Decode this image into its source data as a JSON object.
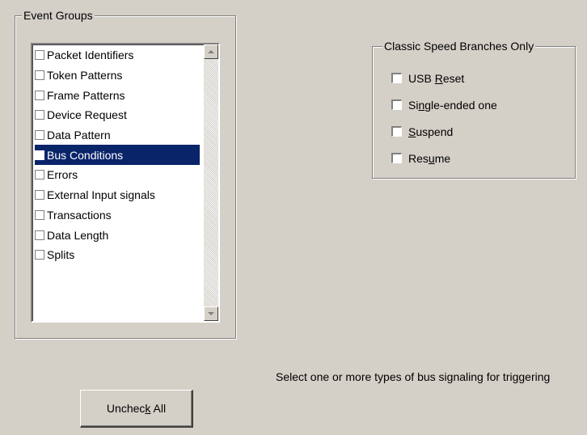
{
  "event_groups": {
    "title": "Event Groups",
    "items": [
      {
        "label": "Packet Identifiers",
        "checked": false,
        "selected": false
      },
      {
        "label": "Token Patterns",
        "checked": false,
        "selected": false
      },
      {
        "label": "Frame Patterns",
        "checked": false,
        "selected": false
      },
      {
        "label": "Device Request",
        "checked": false,
        "selected": false
      },
      {
        "label": "Data Pattern",
        "checked": false,
        "selected": false
      },
      {
        "label": "Bus Conditions",
        "checked": false,
        "selected": true
      },
      {
        "label": "Errors",
        "checked": false,
        "selected": false
      },
      {
        "label": "External Input signals",
        "checked": false,
        "selected": false
      },
      {
        "label": "Transactions",
        "checked": false,
        "selected": false
      },
      {
        "label": "Data Length",
        "checked": false,
        "selected": false
      },
      {
        "label": "Splits",
        "checked": false,
        "selected": false
      }
    ]
  },
  "classic_speed": {
    "title": "Classic Speed Branches Only",
    "options": [
      {
        "pre": "USB ",
        "mnemonic": "R",
        "post": "eset",
        "checked": false
      },
      {
        "pre": "Si",
        "mnemonic": "n",
        "post": "gle-ended one",
        "checked": false
      },
      {
        "pre": "",
        "mnemonic": "S",
        "post": "uspend",
        "checked": false
      },
      {
        "pre": "Res",
        "mnemonic": "u",
        "post": "me",
        "checked": false
      }
    ]
  },
  "uncheck_all": {
    "pre": "Uncheс",
    "mnemonic": "k",
    "post": " All"
  },
  "hint_text": "Select one or more types of bus signaling for triggering"
}
